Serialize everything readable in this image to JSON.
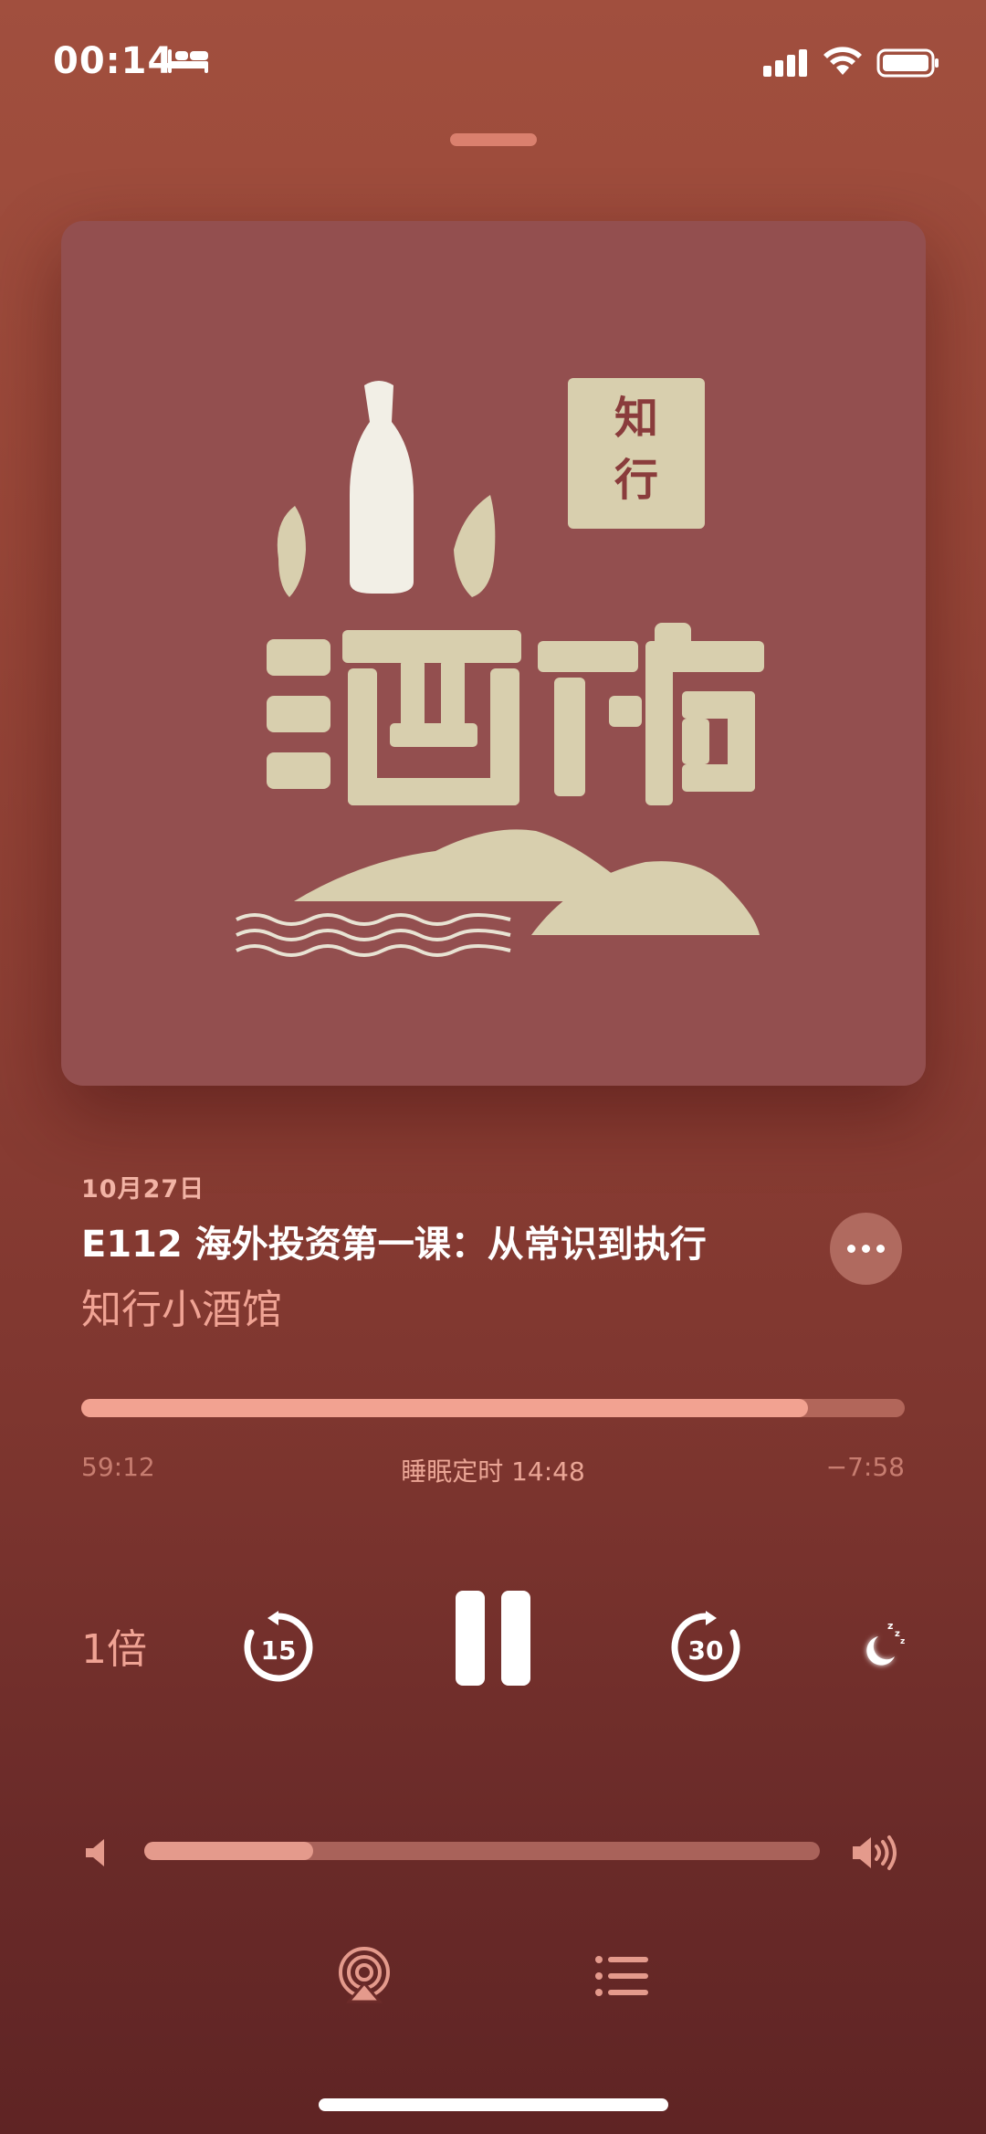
{
  "status_bar": {
    "time": "00:14",
    "icons": [
      "bed-icon",
      "signal-icon",
      "wifi-icon",
      "battery-icon"
    ]
  },
  "artwork": {
    "name": "podcast-cover-art",
    "text_small": "知行",
    "text_large": "小酒馆",
    "background": "#934f4f"
  },
  "episode": {
    "date": "10月27日",
    "title": "E112 海外投资第一课：从常识到执行",
    "podcast": "知行小酒馆"
  },
  "progress": {
    "elapsed": "59:12",
    "remaining": "−7:58",
    "fraction": 0.882,
    "sleep_timer_label": "睡眠定时 14:48"
  },
  "controls": {
    "speed_label": "1倍",
    "skip_back_seconds": "15",
    "skip_forward_seconds": "30",
    "state": "playing"
  },
  "volume": {
    "fraction": 0.25
  },
  "colors": {
    "accent": "#f2a291",
    "secondary_text": "#f0a394",
    "background_top": "#a14f3e",
    "background_bottom": "#5f2424"
  }
}
